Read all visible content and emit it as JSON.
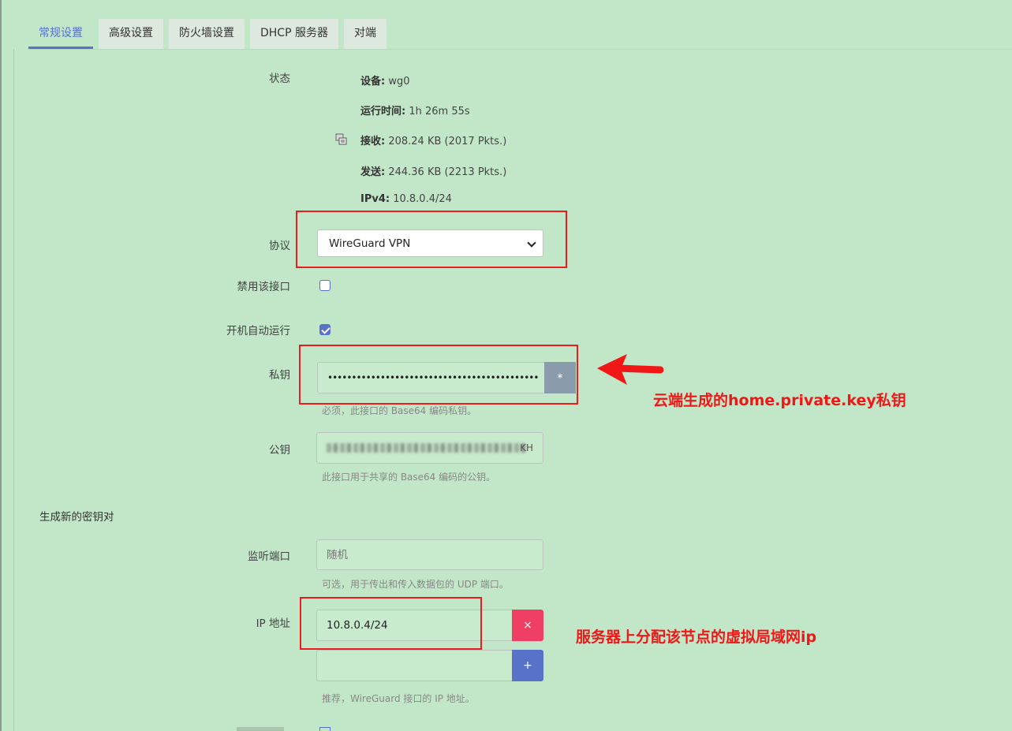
{
  "tabs": [
    "常规设置",
    "高级设置",
    "防火墙设置",
    "DHCP 服务器",
    "对端"
  ],
  "status": {
    "label": "状态",
    "device_key": "设备:",
    "device_value": " wg0",
    "uptime_key": "运行时间:",
    "uptime_value": " 1h 26m 55s",
    "rx_key": "接收:",
    "rx_value": " 208.24 KB (2017 Pkts.)",
    "tx_key": "发送:",
    "tx_value": " 244.36 KB (2213 Pkts.)",
    "ipv4_key": "IPv4:",
    "ipv4_value": " 10.8.0.4/24",
    "icon": "network-interface-icon"
  },
  "protocol": {
    "label": "协议",
    "value": "WireGuard VPN"
  },
  "disable_iface": {
    "label": "禁用该接口",
    "checked": false
  },
  "autostart": {
    "label": "开机自动运行",
    "checked": true
  },
  "private_key": {
    "label": "私钥",
    "value": "••••••••••••••••••••••••••••••••••••••••••••",
    "reveal_button": "*",
    "help": "必须，此接口的 Base64 编码私钥。"
  },
  "public_key": {
    "label": "公钥",
    "value": "KH",
    "help": "此接口用于共享的 Base64 编码的公钥。"
  },
  "generate_keypair": "生成新的密钥对",
  "listen_port": {
    "label": "监听端口",
    "placeholder": "随机",
    "help": "可选，用于传出和传入数据包的 UDP 端口。"
  },
  "ip_address": {
    "label": "IP 地址",
    "value": "10.8.0.4/24",
    "remove_button": "×",
    "add_button": "+",
    "help": "推荐，WireGuard 接口的 IP 地址。"
  },
  "annotations": {
    "private_key_note": "云端生成的home.private.key私钥",
    "ip_note": "服务器上分配该节点的虚拟局域网ip"
  },
  "colors": {
    "background": "#c2e6c8",
    "accent": "#5872c9",
    "danger": "#ef3f64",
    "annotation": "#f01717"
  }
}
